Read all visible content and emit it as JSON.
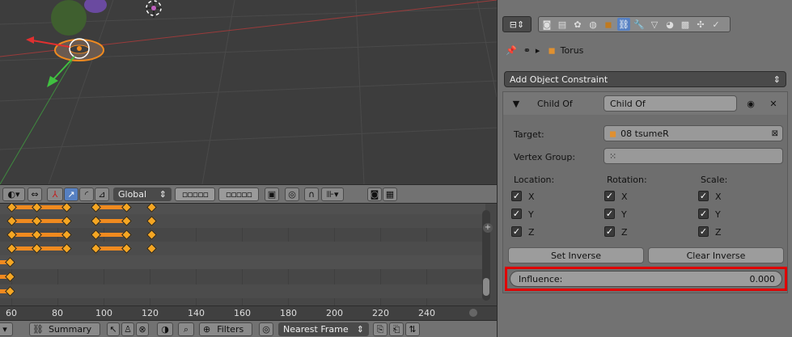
{
  "viewport": {
    "header": {
      "orientation_label": "Global"
    }
  },
  "dopesheet": {
    "frame_ticks": [
      "60",
      "80",
      "100",
      "120",
      "140",
      "160",
      "180",
      "200",
      "220",
      "240"
    ],
    "footer": {
      "summary_label": "Summary",
      "filters_label": "Filters",
      "snap_mode": "Nearest Frame"
    }
  },
  "properties": {
    "breadcrumb_object": "Torus",
    "add_constraint_label": "Add Object Constraint",
    "constraint": {
      "type_label": "Child Of",
      "name_value": "Child Of",
      "target_label": "Target:",
      "target_value": "08 tsumeR",
      "vertex_group_label": "Vertex Group:",
      "location_label": "Location:",
      "rotation_label": "Rotation:",
      "scale_label": "Scale:",
      "axis_x": "X",
      "axis_y": "Y",
      "axis_z": "Z",
      "set_inverse_label": "Set Inverse",
      "clear_inverse_label": "Clear Inverse",
      "influence_label": "Influence:",
      "influence_value": "0.000"
    }
  },
  "colors": {
    "highlight_box": "#e00000",
    "keyframe": "#f5a623",
    "hold_bar": "#f08a1f",
    "selected_button": "#5680c2"
  }
}
